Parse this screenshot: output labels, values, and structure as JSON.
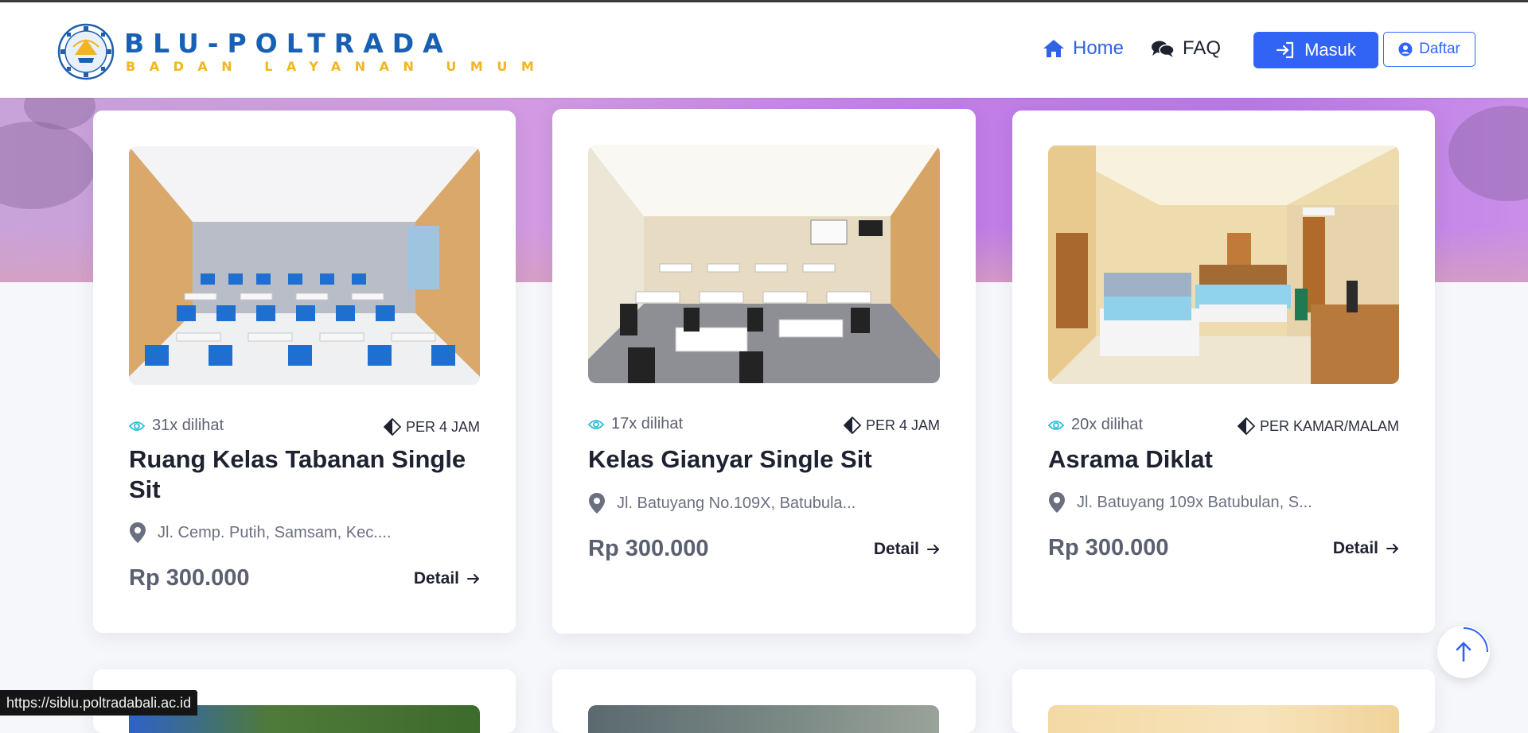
{
  "brand": {
    "title": "BLU-POLTRADA",
    "subtitle": "BADAN LAYANAN UMUM"
  },
  "nav": {
    "home": "Home",
    "faq": "FAQ",
    "login": "Masuk",
    "register": "Daftar"
  },
  "colors": {
    "primary": "#3164f4",
    "brand_blue": "#1760b4",
    "brand_gold": "#f2b51d",
    "hero": "#c884e6"
  },
  "cards": [
    {
      "views": "31x dilihat",
      "rate": "PER 4 JAM",
      "title": "Ruang Kelas Tabanan Single Sit",
      "address": "Jl. Cemp. Putih, Samsam, Kec....",
      "price": "Rp 300.000",
      "detail": "Detail",
      "image": "classroom-blue-chairs"
    },
    {
      "views": "17x dilihat",
      "rate": "PER 4 JAM",
      "title": "Kelas Gianyar Single Sit",
      "address": "Jl. Batuyang No.109X, Batubula...",
      "price": "Rp 300.000",
      "detail": "Detail",
      "image": "classroom-black-chairs"
    },
    {
      "views": "20x dilihat",
      "rate": "PER KAMAR/MALAM",
      "title": "Asrama Diklat",
      "address": "Jl. Batuyang 109x Batubulan, S...",
      "price": "Rp 300.000",
      "detail": "Detail",
      "image": "dormitory-room"
    }
  ],
  "status_url": "https://siblu.poltradabali.ac.id"
}
